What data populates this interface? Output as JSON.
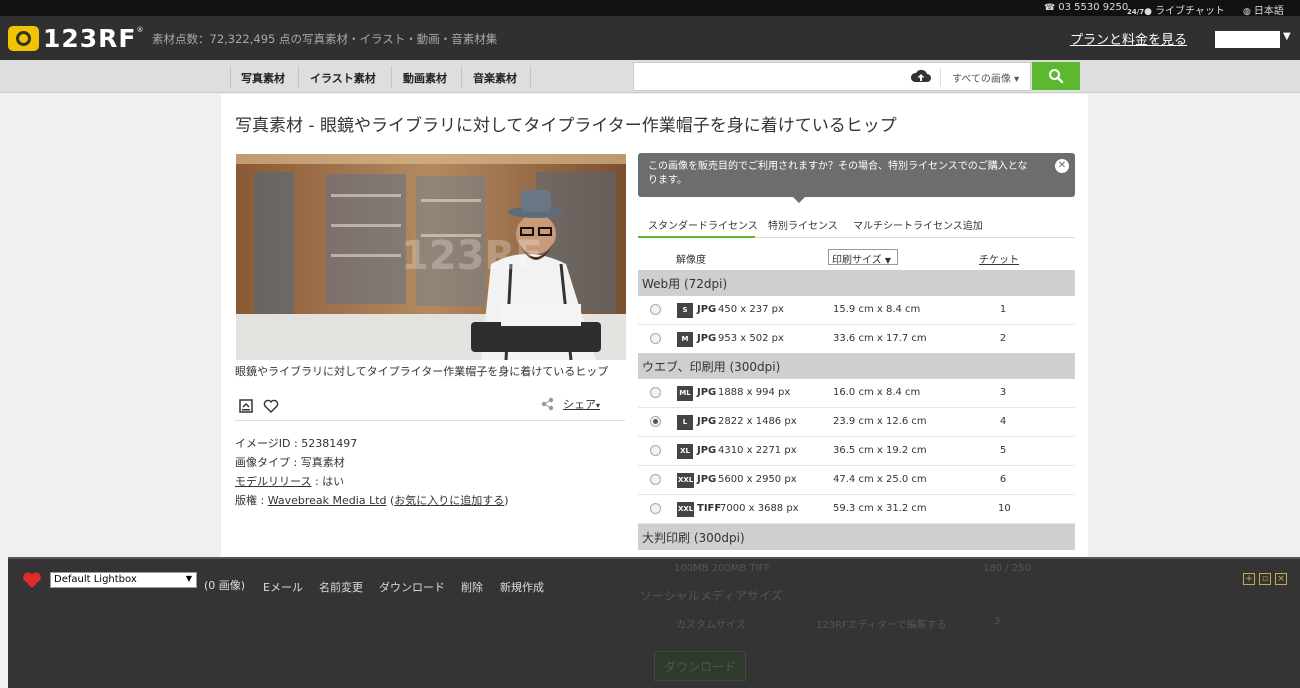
{
  "topbar": {
    "phone": "03 5530 9250",
    "live_chat_prefix": "24/7",
    "live_chat": "ライブチャット",
    "language": "日本語"
  },
  "header": {
    "logo_text": "123RF",
    "logo_reg": "®",
    "tagline": "素材点数：72,322,495 点の写真素材・イラスト・動画・音素材集",
    "plans_link": "プランと料金を見る"
  },
  "nav": {
    "items": [
      "写真素材",
      "イラスト素材",
      "動画素材",
      "音楽素材"
    ],
    "search_placeholder": "",
    "search_filter": "すべての画像 ▾"
  },
  "page": {
    "title": "写真素材 - 眼鏡やライブラリに対してタイプライター作業帽子を身に着けているヒップ",
    "caption": "眼鏡やライブラリに対してタイプライター作業帽子を身に着けているヒップ",
    "share": "シェア",
    "meta": {
      "image_id_label": "イメージID",
      "image_id": "52381497",
      "type_label": "画像タイプ",
      "type_value": "写真素材",
      "model_label": "モデルリリース",
      "model_value": "はい",
      "copyright_label": "版権",
      "copyright_value": "Wavebreak Media Ltd",
      "fav_link": "お気に入りに追加する"
    }
  },
  "license": {
    "notice": "この画像を販売目的でご利用されますか？その場合、特別ライセンスでのご購入となります。",
    "tabs": [
      "スタンダードライセンス",
      "特別ライセンス",
      "マルチシートライセンス追加"
    ],
    "col_resolution": "解像度",
    "col_print_size": "印刷サイズ",
    "col_ticket": "チケット",
    "sections": [
      {
        "title": "Web用 (72dpi)",
        "rows": [
          {
            "size": "S",
            "format": "JPG",
            "px": "450 x 237 px",
            "cm": "15.9 cm x 8.4 cm",
            "tickets": "1",
            "selected": false
          },
          {
            "size": "M",
            "format": "JPG",
            "px": "953 x 502 px",
            "cm": "33.6 cm x 17.7 cm",
            "tickets": "2",
            "selected": false
          }
        ]
      },
      {
        "title": "ウエブ、印刷用 (300dpi)",
        "rows": [
          {
            "size": "ML",
            "format": "JPG",
            "px": "1888 x 994 px",
            "cm": "16.0 cm x 8.4 cm",
            "tickets": "3",
            "selected": false
          },
          {
            "size": "L",
            "format": "JPG",
            "px": "2822 x 1486 px",
            "cm": "23.9 cm x 12.6 cm",
            "tickets": "4",
            "selected": true
          },
          {
            "size": "XL",
            "format": "JPG",
            "px": "4310 x 2271 px",
            "cm": "36.5 cm x 19.2 cm",
            "tickets": "5",
            "selected": false
          },
          {
            "size": "XXL",
            "format": "JPG",
            "px": "5600 x 2950 px",
            "cm": "47.4 cm x 25.0 cm",
            "tickets": "6",
            "selected": false
          },
          {
            "size": "XXL",
            "format": "TIFF",
            "px": "7000 x 3688 px",
            "cm": "59.3 cm x 31.2 cm",
            "tickets": "10",
            "selected": false
          }
        ]
      },
      {
        "title": "大判印刷 (300dpi)",
        "rows": []
      }
    ],
    "behind": {
      "large_row": "100MB 200MB TIFF",
      "large_tickets": "180 / 250",
      "social_title": "ソーシャルメディアサイズ",
      "custom_label": "カスタムサイズ",
      "custom_editor": "123RFエディターで編集する",
      "custom_tickets": "3",
      "download_btn": "ダウンロード"
    }
  },
  "lightbox": {
    "selected": "Default Lightbox",
    "count": "(0 画像)",
    "actions": [
      "Eメール",
      "名前変更",
      "ダウンロード",
      "削除",
      "新規作成"
    ]
  },
  "colors": {
    "header_bg": "#303030",
    "accent_green": "#5cb82f",
    "logo_yellow": "#f2c300",
    "heart_red": "#e02b2b"
  }
}
